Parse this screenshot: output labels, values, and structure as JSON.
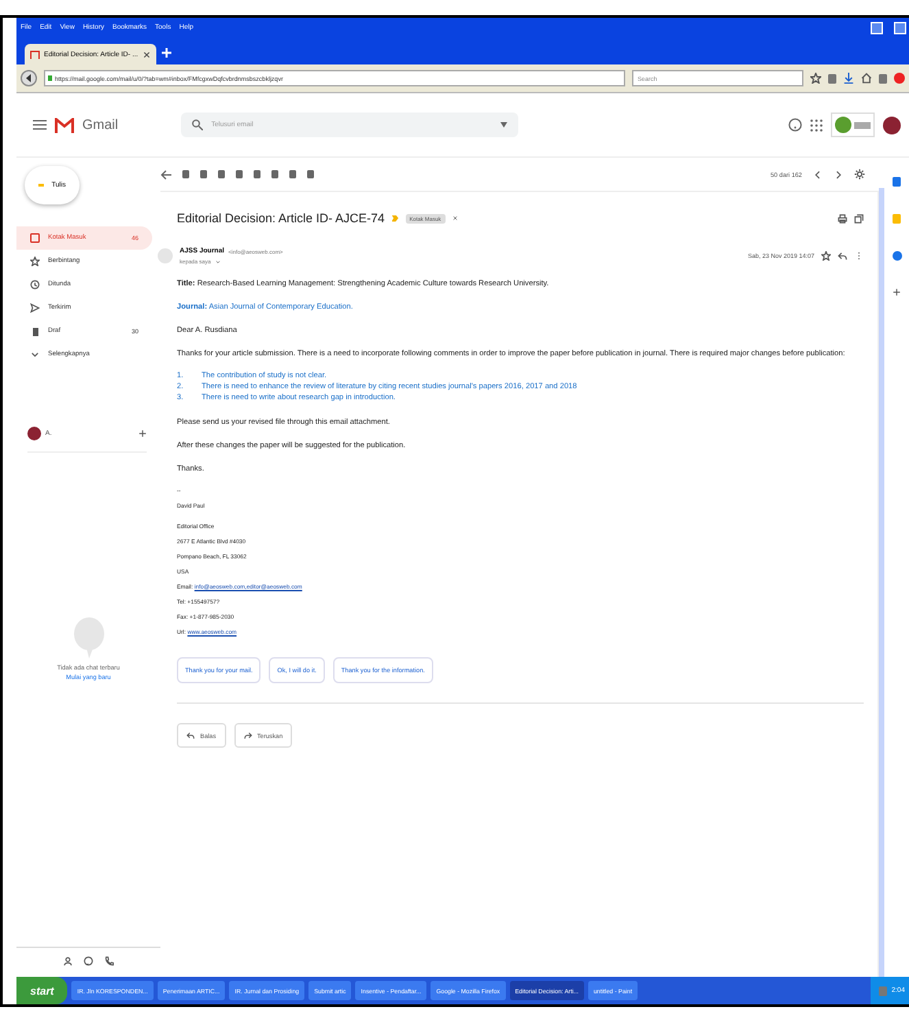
{
  "browser": {
    "menu": [
      "File",
      "Edit",
      "View",
      "History",
      "Bookmarks",
      "Tools",
      "Help"
    ],
    "tabs": [
      {
        "title": "Editorial Decision: Article ID- ...",
        "selected": true
      }
    ],
    "url": "https://mail.google.com/mail/u/0/?tab=wm#inbox/FMfcgxwDqfcvbrdnmsbszcbkljzqvr",
    "search_placeholder": "Search"
  },
  "gmail": {
    "product": "Gmail",
    "search_placeholder": "Telusuri email",
    "compose": "Tulis",
    "folders": [
      {
        "kind": "inbox",
        "label": "Kotak Masuk",
        "count": "46",
        "selected": true
      },
      {
        "kind": "starred",
        "label": "Berbintang",
        "selected": false
      },
      {
        "kind": "snoozed",
        "label": "Ditunda",
        "selected": false
      },
      {
        "kind": "sent",
        "label": "Terkirim",
        "selected": false
      },
      {
        "kind": "drafts",
        "label": "Draf",
        "count": "30",
        "selected": false
      },
      {
        "kind": "more",
        "label": "Selengkapnya",
        "selected": false
      }
    ],
    "account_name": "A.",
    "chat_empty": "Tidak ada chat terbaru",
    "chat_start": "Mulai yang baru",
    "pager": "50 dari 162"
  },
  "message": {
    "subject": "Editorial Decision: Article ID- AJCE-74",
    "label": "Kotak Masuk",
    "sender": "AJSS Journal",
    "sender_email": "<info@aeosweb.com>",
    "recipient": "kepada saya",
    "date": "Sab, 23 Nov 2019 14:07",
    "title_line": "**Title:** Research-Based Learning Management: Strengthening Academic Culture towards Research University.",
    "journal_line": "**Journal:** Asian Journal of Contemporary Education.",
    "greeting": "Dear  A. Rusdiana",
    "intro": "Thanks for your article submission. There is a need to incorporate following comments in order to improve the paper before publication in journal. There is required major changes before publication:",
    "points": [
      {
        "number": "1.",
        "text": "The contribution of study is not clear."
      },
      {
        "number": "2.",
        "text": "There is need to enhance the review of literature by citing recent studies journal's papers 2016, 2017 and 2018"
      },
      {
        "number": "3.",
        "text": "There is need to write about research gap in introduction."
      }
    ],
    "closing": [
      "Please send us your revised file through this email attachment.",
      "After these changes the paper will be suggested for the publication.",
      "Thanks."
    ],
    "signature": [
      "--",
      "David Paul"
    ],
    "address": [
      "Editorial Office",
      "2677 E Atlantic Blvd #4030",
      "Pompano Beach, FL 33062",
      "USA"
    ],
    "email_label": "Email:",
    "email_link": "info@aeosweb.com,editor@aeosweb.com",
    "tel": "Tel: +15549757?",
    "fax": "Fax: +1-877-985-2030",
    "url_label": "Url:",
    "url_link": "www.aeosweb.com",
    "smart_replies": [
      "Thank you for your mail.",
      "Ok, I will do it.",
      "Thank you for the information."
    ],
    "actions": [
      "Balas",
      "Teruskan"
    ]
  },
  "taskbar": {
    "start": "start",
    "items": [
      {
        "title": "IR. Jln KORESPONDEN...",
        "selected": false
      },
      {
        "title": "Penerimaan ARTIC...",
        "selected": false
      },
      {
        "title": "IR. Jurnal dan Prosiding",
        "selected": false
      },
      {
        "title": "Submit artic",
        "selected": false
      },
      {
        "title": "Insentive - Pendaftar...",
        "selected": false
      },
      {
        "title": "Google - Mozilla Firefox",
        "selected": false
      },
      {
        "title": "Editorial Decision: Arti...",
        "selected": true
      },
      {
        "title": "untitled - Paint",
        "selected": false
      }
    ],
    "clock": "2:04"
  }
}
